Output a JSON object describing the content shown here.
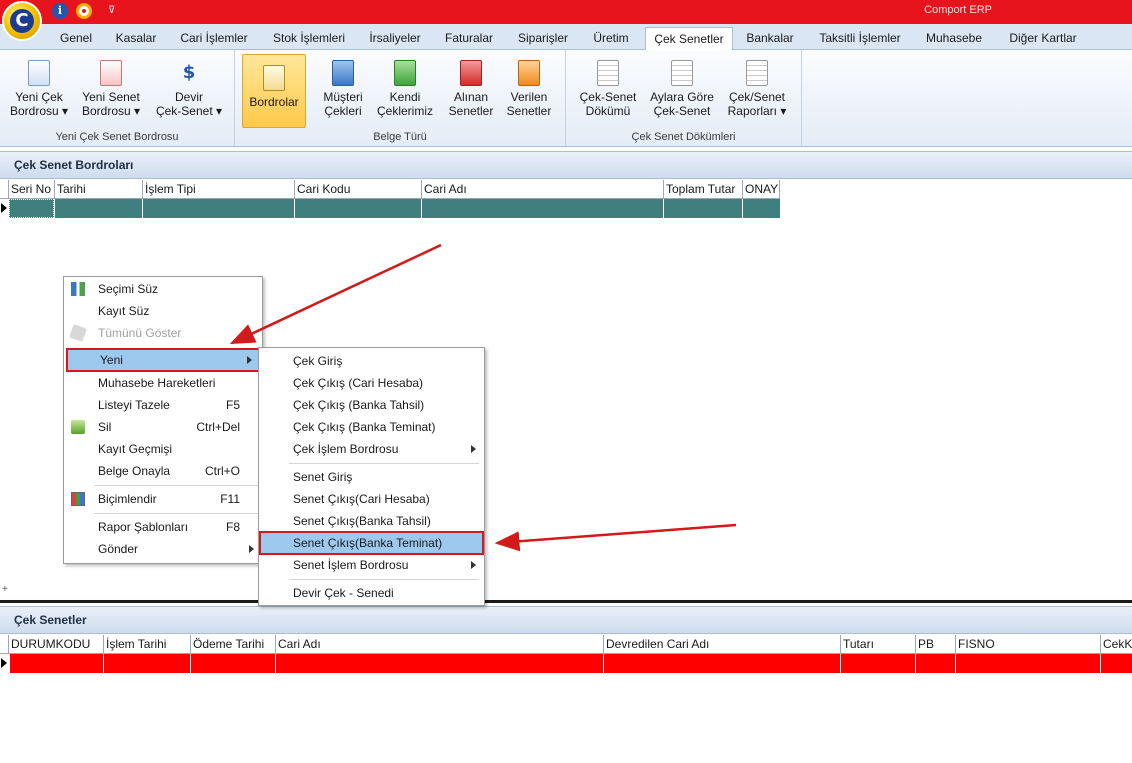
{
  "window": {
    "title": "Comport ERP",
    "logo_letter": "C",
    "info_glyph": "i",
    "quick_access_glyph": "⊽"
  },
  "tabs": [
    {
      "label": "Genel"
    },
    {
      "label": "Kasalar"
    },
    {
      "label": "Cari İşlemler"
    },
    {
      "label": "Stok İşlemleri"
    },
    {
      "label": "İrsaliyeler"
    },
    {
      "label": "Faturalar"
    },
    {
      "label": "Siparişler"
    },
    {
      "label": "Üretim"
    },
    {
      "label": "Çek Senetler",
      "active": true
    },
    {
      "label": "Bankalar"
    },
    {
      "label": "Taksitli İşlemler"
    },
    {
      "label": "Muhasebe"
    },
    {
      "label": "Diğer Kartlar"
    }
  ],
  "ribbon": {
    "groups": [
      {
        "label": "Yeni Çek Senet Bordrosu",
        "buttons": [
          {
            "label": "Yeni Çek\nBordrosu ▾",
            "icon": "new-cheque-doc-icon"
          },
          {
            "label": "Yeni Senet\nBordrosu ▾",
            "icon": "new-note-doc-icon"
          },
          {
            "label": "Devir\nÇek-Senet ▾",
            "icon": "transfer-money-icon",
            "glyph": "$"
          }
        ]
      },
      {
        "label": "Belge Türü",
        "buttons": [
          {
            "label": "Bordrolar",
            "icon": "bordro-edit-icon",
            "selected": true
          },
          {
            "label": "Müşteri\nÇekleri",
            "icon": "customer-cheque-icon"
          },
          {
            "label": "Kendi\nÇeklerimiz",
            "icon": "own-cheque-icon"
          },
          {
            "label": "Alınan\nSenetler",
            "icon": "received-note-icon"
          },
          {
            "label": "Verilen\nSenetler",
            "icon": "given-note-icon"
          }
        ]
      },
      {
        "label": "Çek Senet Dökümleri",
        "buttons": [
          {
            "label": "Çek-Senet\nDökümü",
            "icon": "report-paper-icon"
          },
          {
            "label": "Aylara Göre\nÇek-Senet",
            "icon": "monthly-report-icon"
          },
          {
            "label": "Çek/Senet\nRaporları ▾",
            "icon": "reports-stack-icon"
          }
        ]
      }
    ]
  },
  "top_panel": {
    "title": "Çek Senet Bordroları",
    "columns": [
      "Seri No",
      "Tarihi",
      "İşlem Tipi",
      "Cari Kodu",
      "Cari Adı",
      "Toplam Tutar",
      "ONAY"
    ],
    "row_color": "#3f7f7e"
  },
  "bottom_panel": {
    "title": "Çek Senetler",
    "columns": [
      "DURUMKODU",
      "İşlem Tarihi",
      "Ödeme Tarihi",
      "Cari Adı",
      "Devredilen Cari Adı",
      "Tutarı",
      "PB",
      "FISNO",
      "CekKa"
    ],
    "row_color": "#ff0000"
  },
  "context_menu": {
    "items": [
      {
        "label": "Seçimi Süz",
        "icon": "filter-selection-icon"
      },
      {
        "label": "Kayıt Süz"
      },
      {
        "label": "Tümünü Göster",
        "disabled": true,
        "icon": "show-all-icon"
      },
      {
        "label": "Yeni",
        "submenu": true,
        "highlighted": true
      },
      {
        "label": "Muhasebe Hareketleri"
      },
      {
        "label": "Listeyi Tazele",
        "shortcut": "F5"
      },
      {
        "label": "Sil",
        "shortcut": "Ctrl+Del",
        "icon": "delete-icon"
      },
      {
        "label": "Kayıt Geçmişi"
      },
      {
        "label": "Belge Onayla",
        "shortcut": "Ctrl+O"
      },
      {
        "label": "Biçimlendir",
        "shortcut": "F11",
        "icon": "format-icon"
      },
      {
        "label": "Rapor Şablonları",
        "shortcut": "F8"
      },
      {
        "label": "Gönder",
        "submenu": true
      }
    ]
  },
  "submenu": {
    "items": [
      {
        "label": "Çek Giriş"
      },
      {
        "label": "Çek Çıkış (Cari Hesaba)"
      },
      {
        "label": "Çek Çıkış (Banka Tahsil)"
      },
      {
        "label": "Çek Çıkış (Banka Teminat)"
      },
      {
        "label": "Çek İşlem Bordrosu",
        "submenu": true
      },
      {
        "label": "Senet Giriş"
      },
      {
        "label": "Senet Çıkış(Cari Hesaba)"
      },
      {
        "label": "Senet Çıkış(Banka Tahsil)"
      },
      {
        "label": "Senet Çıkış(Banka Teminat)",
        "highlighted": true
      },
      {
        "label": "Senet İşlem Bordrosu",
        "submenu": true
      },
      {
        "label": "Devir Çek - Senedi"
      }
    ]
  },
  "footer": {
    "marker": "+"
  },
  "colors": {
    "titlebar": "#e8141d",
    "annotation": "#d31a1a",
    "highlight": "#9ec9ef"
  }
}
